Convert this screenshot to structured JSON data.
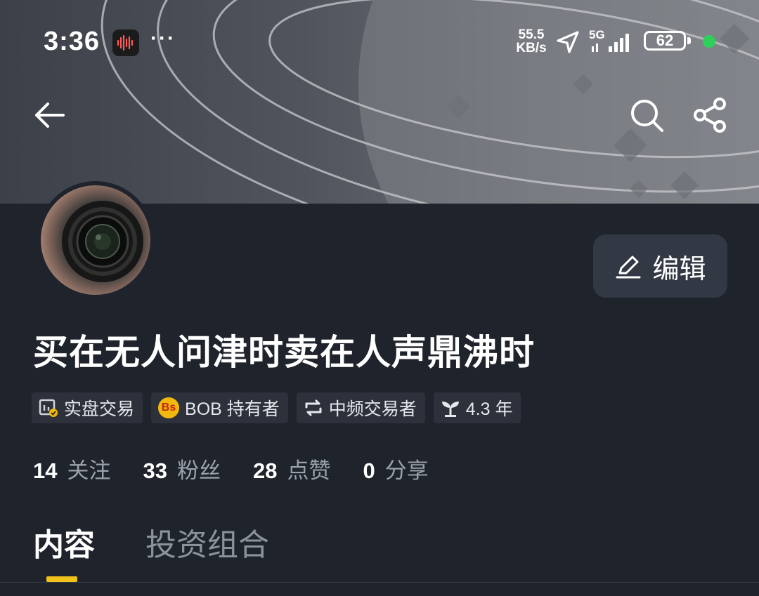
{
  "status_bar": {
    "time": "3:36",
    "menu_dots": "···",
    "net_speed_value": "55.5",
    "net_speed_unit": "KB/s",
    "network": "5G",
    "battery": "62",
    "icons": [
      "recorder-icon",
      "location-arrow-icon",
      "signal-icon",
      "battery-icon"
    ]
  },
  "nav": {
    "icons": [
      "back-arrow-icon",
      "search-icon",
      "share-icon"
    ]
  },
  "profile": {
    "edit_label": "编辑",
    "username": "买在无人问津时卖在人声鼎沸时"
  },
  "tags": [
    {
      "icon": "trading-chart-icon",
      "label": "实盘交易"
    },
    {
      "icon": "bs-token-icon",
      "icon_text": "Bs",
      "label": "BOB 持有者"
    },
    {
      "icon": "exchange-icon",
      "label": "中频交易者"
    },
    {
      "icon": "sprout-icon",
      "label": "4.3 年"
    }
  ],
  "stats": [
    {
      "value": "14",
      "label": "关注"
    },
    {
      "value": "33",
      "label": "粉丝"
    },
    {
      "value": "28",
      "label": "点赞"
    },
    {
      "value": "0",
      "label": "分享"
    }
  ],
  "tabs": [
    {
      "label": "内容",
      "active": true
    },
    {
      "label": "投资组合",
      "active": false
    }
  ],
  "colors": {
    "background": "#1f232c",
    "accent": "#f0c21a",
    "tag_bg": "#2c313b",
    "status_green": "#2fd05a"
  }
}
